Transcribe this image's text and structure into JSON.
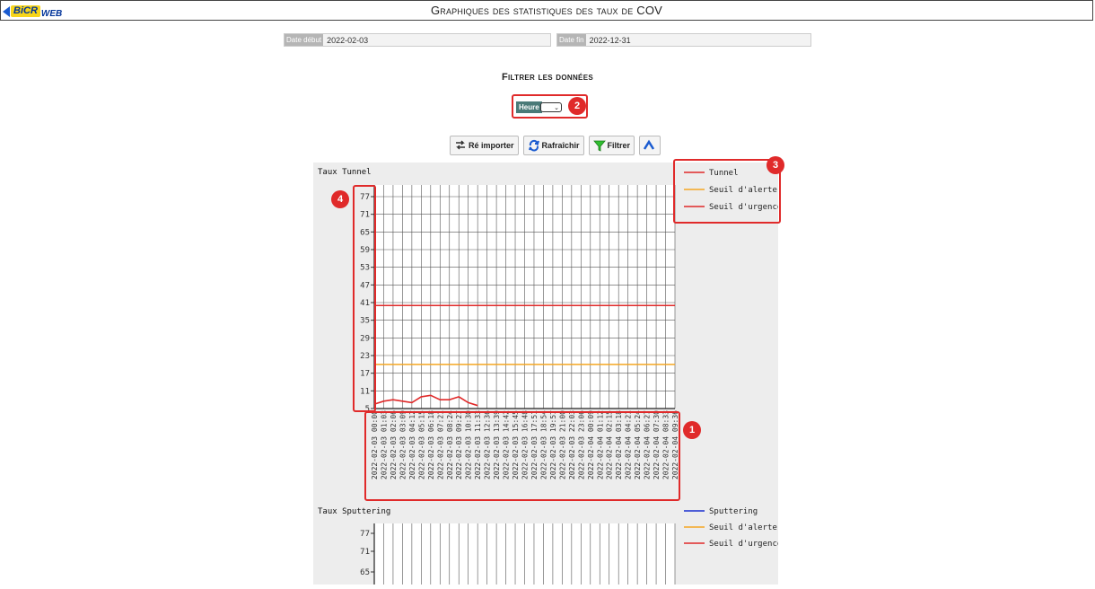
{
  "header": {
    "logo_text": "BiCR",
    "logo_suffix": "WEB",
    "title": "Graphiques des statistiques des taux de COV"
  },
  "dates": {
    "start_label": "Date début",
    "start_value": "2022-02-03",
    "end_label": "Date fin",
    "end_value": "2022-12-31"
  },
  "filter": {
    "title": "Filtrer les données",
    "hour_label": "Heure",
    "hour_value": ""
  },
  "buttons": {
    "reimport": "Ré importer",
    "refresh": "Rafraîchir",
    "filter": "Filtrer"
  },
  "badges": {
    "b1": "1",
    "b2": "2",
    "b3": "3",
    "b4": "4"
  },
  "colors": {
    "alert": "#f5a623",
    "urgent": "#e02a2a",
    "tunnel": "#e02a2a",
    "sputtering": "#1a2fd0",
    "badge": "#e02a2a"
  },
  "chart_data": [
    {
      "type": "line",
      "title": "Taux Tunnel",
      "y_ticks": [
        5,
        11,
        17,
        23,
        29,
        35,
        41,
        47,
        53,
        59,
        65,
        71,
        77
      ],
      "ylim": [
        5,
        77
      ],
      "x": [
        "2022-02-03 00:00",
        "2022-02-03 01:03",
        "2022-02-03 02:06",
        "2022-02-03 03:09",
        "2022-02-03 04:12",
        "2022-02-03 05:15",
        "2022-02-03 06:18",
        "2022-02-03 07:21",
        "2022-02-03 08:24",
        "2022-02-03 09:27",
        "2022-02-03 10:30",
        "2022-02-03 11:33",
        "2022-02-03 12:36",
        "2022-02-03 13:39",
        "2022-02-03 14:42",
        "2022-02-03 15:45",
        "2022-02-03 16:48",
        "2022-02-03 17:51",
        "2022-02-03 18:54",
        "2022-02-03 19:57",
        "2022-02-03 21:00",
        "2022-02-03 22:03",
        "2022-02-03 23:06",
        "2022-02-04 00:09",
        "2022-02-04 01:12",
        "2022-02-04 02:15",
        "2022-02-04 03:18",
        "2022-02-04 04:21",
        "2022-02-04 05:24",
        "2022-02-04 06:27",
        "2022-02-04 07:30",
        "2022-02-04 08:33",
        "2022-02-04 09:36"
      ],
      "series": [
        {
          "name": "Tunnel",
          "color": "#e02a2a",
          "values": [
            6.5,
            7.5,
            8,
            7.5,
            7,
            9,
            9.5,
            8,
            8,
            9,
            7,
            6,
            null,
            null,
            null,
            null,
            null,
            null,
            null,
            null,
            null,
            null,
            null,
            null,
            null,
            null,
            null,
            null,
            null,
            null,
            null,
            null,
            null
          ]
        },
        {
          "name": "Seuil d'alerte",
          "color": "#f5a623",
          "constant": 20
        },
        {
          "name": "Seuil d'urgence",
          "color": "#e02a2a",
          "constant": 40
        }
      ],
      "grid": true,
      "legend": "top-right"
    },
    {
      "type": "line",
      "title": "Taux Sputtering",
      "y_ticks": [
        65,
        71,
        77
      ],
      "series": [
        {
          "name": "Sputtering",
          "color": "#1a2fd0"
        },
        {
          "name": "Seuil d'alerte",
          "color": "#f5a623"
        },
        {
          "name": "Seuil d'urgence",
          "color": "#e02a2a"
        }
      ],
      "grid": true,
      "legend": "top-right"
    }
  ]
}
